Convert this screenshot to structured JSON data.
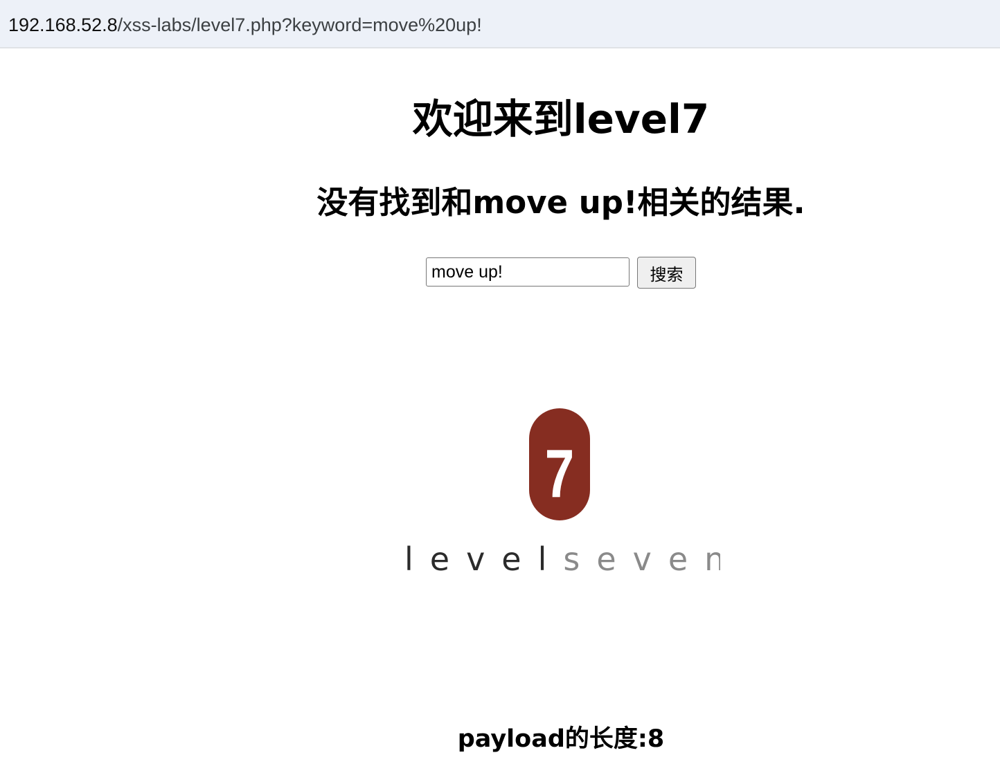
{
  "browser": {
    "url_host": "192.168.52.8",
    "url_path": "/xss-labs/level7.php?keyword=move%20up!"
  },
  "page": {
    "title": "欢迎来到level7",
    "result_message": "没有找到和move up!相关的结果.",
    "search": {
      "value": "move up!",
      "button_label": "搜索"
    },
    "logo": {
      "badge_text": "7",
      "wordmark_dark": "level",
      "wordmark_light": "seven",
      "badge_color": "#862d21"
    },
    "payload_label": "payload的长度:",
    "payload_length": "8"
  }
}
